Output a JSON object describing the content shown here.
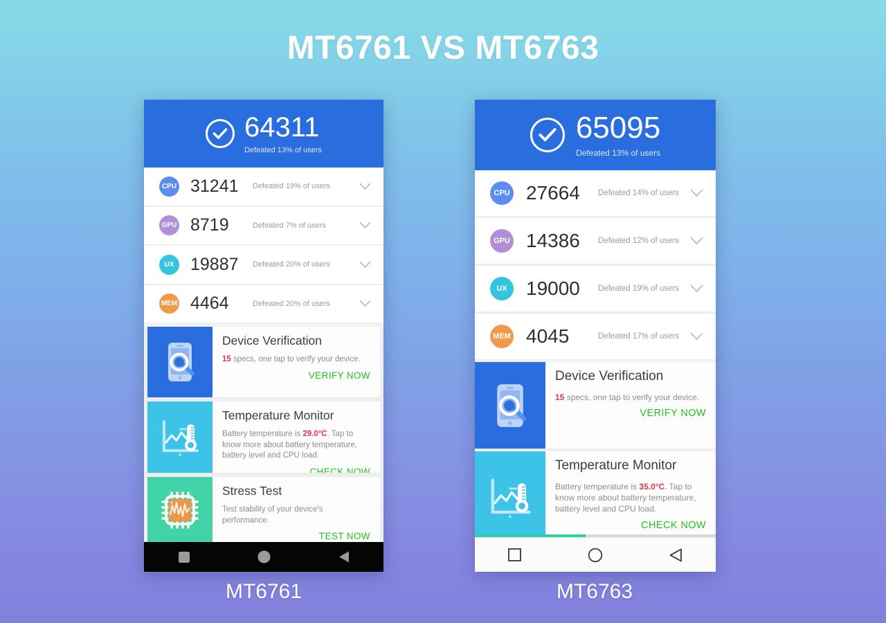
{
  "page": {
    "title": "MT6761 VS MT6763"
  },
  "phones": [
    {
      "caption": "MT6761",
      "header": {
        "total_score": "64311",
        "subtitle": "Defeated 13% of users",
        "check_icon": "check-circle-icon",
        "bg_color": "#2a6ddf"
      },
      "rows": [
        {
          "badge": "CPU",
          "color": "#5b8def",
          "score": "31241",
          "sub": "Defeated 19% of users",
          "chevron": "chevron-down-icon"
        },
        {
          "badge": "GPU",
          "color": "#b08fd8",
          "score": "8719",
          "sub": "Defeated 7% of users",
          "chevron": "chevron-down-icon"
        },
        {
          "badge": "UX",
          "color": "#35c4dd",
          "score": "19887",
          "sub": "Defeated 20% of users",
          "chevron": "chevron-down-icon"
        },
        {
          "badge": "MEM",
          "color": "#ee9a4a",
          "score": "4464",
          "sub": "Defeated 20% of users",
          "chevron": "chevron-down-icon"
        }
      ],
      "cards": [
        {
          "icon": "phone-magnifier-icon",
          "thumb_color": "#2a6ddf",
          "title": "Device Verification",
          "highlight": "15",
          "desc": " specs, one tap to verify your device.",
          "action": "VERIFY NOW"
        },
        {
          "icon": "thermometer-chart-icon",
          "thumb_color": "#3dc2e8",
          "title": "Temperature Monitor",
          "desc_before": "Battery temperature is ",
          "highlight": "29.0°C",
          "desc_after": ". Tap to know more about battery temperature, battery level and CPU load.",
          "action": "CHECK NOW"
        },
        {
          "icon": "cpu-waveform-icon",
          "thumb_color": "#43d3a8",
          "title": "Stress Test",
          "desc": "Test stability of your device's performance.",
          "action": "TEST NOW"
        }
      ],
      "navbar": {
        "style": "dark",
        "buttons": [
          "recents-square-icon",
          "home-circle-icon",
          "back-triangle-icon"
        ]
      },
      "progress": null
    },
    {
      "caption": "MT6763",
      "header": {
        "total_score": "65095",
        "subtitle": "Defeated 13% of users",
        "check_icon": "check-circle-icon",
        "bg_color": "#2a6ddf"
      },
      "rows": [
        {
          "badge": "CPU",
          "color": "#5b8def",
          "score": "27664",
          "sub": "Defeated 14% of users",
          "chevron": "chevron-down-icon"
        },
        {
          "badge": "GPU",
          "color": "#b08fd8",
          "score": "14386",
          "sub": "Defeated 12% of users",
          "chevron": "chevron-down-icon"
        },
        {
          "badge": "UX",
          "color": "#35c4dd",
          "score": "19000",
          "sub": "Defeated 19% of users",
          "chevron": "chevron-down-icon"
        },
        {
          "badge": "MEM",
          "color": "#ee9a4a",
          "score": "4045",
          "sub": "Defeated 17% of users",
          "chevron": "chevron-down-icon"
        }
      ],
      "cards": [
        {
          "icon": "phone-magnifier-icon",
          "thumb_color": "#2a6ddf",
          "title": "Device Verification",
          "highlight": "15",
          "desc": " specs, one tap to verify your device.",
          "action": "VERIFY NOW"
        },
        {
          "icon": "thermometer-chart-icon",
          "thumb_color": "#3dc2e8",
          "title": "Temperature Monitor",
          "desc_before": "Battery temperature is ",
          "highlight": "35.0°C",
          "desc_after": ". Tap to know more about battery temperature, battery level and CPU load.",
          "action": "CHECK NOW"
        }
      ],
      "navbar": {
        "style": "light",
        "buttons": [
          "recents-square-icon",
          "home-circle-icon",
          "back-triangle-icon"
        ]
      },
      "progress": {
        "percent": 46,
        "color": "#2ecfa2"
      }
    }
  ]
}
